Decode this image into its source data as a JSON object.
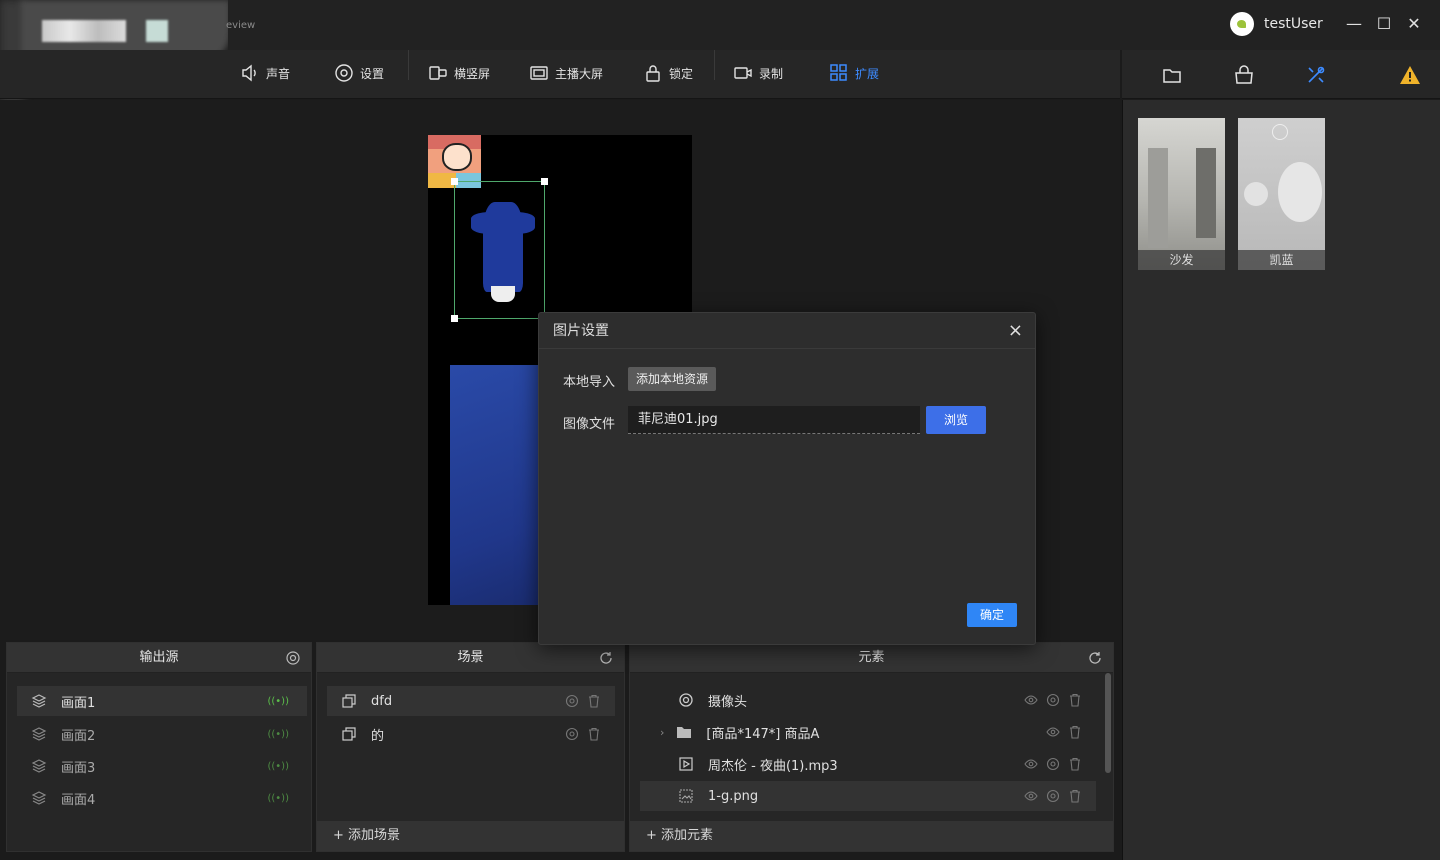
{
  "titlebar": {
    "preview_text": "eview",
    "username": "testUser",
    "minimize": "—",
    "maximize": "☐",
    "close": "✕"
  },
  "toolbar": {
    "items": [
      {
        "label": "声音",
        "icon": "speaker-icon"
      },
      {
        "label": "设置",
        "icon": "gear-icon"
      },
      {
        "label": "横竖屏",
        "icon": "rotate-screen-icon"
      },
      {
        "label": "主播大屏",
        "icon": "fullscreen-icon"
      },
      {
        "label": "锁定",
        "icon": "lock-icon"
      },
      {
        "label": "录制",
        "icon": "video-record-icon"
      },
      {
        "label": "扩展",
        "icon": "grid-icon",
        "active": true
      }
    ],
    "accent_color": "#3d8bff"
  },
  "right_panel": {
    "tabs": [
      "folder-icon",
      "shop-bag-icon",
      "tools-icon",
      "warning-icon"
    ],
    "assets": [
      {
        "label": "沙发"
      },
      {
        "label": "凯蓝"
      }
    ]
  },
  "panels": {
    "output": {
      "title": "输出源",
      "items": [
        {
          "label": "画面1",
          "selected": true
        },
        {
          "label": "画面2"
        },
        {
          "label": "画面3"
        },
        {
          "label": "画面4"
        }
      ]
    },
    "scenes": {
      "title": "场景",
      "items": [
        {
          "label": "dfd",
          "selected": true
        },
        {
          "label": "的"
        }
      ],
      "add_label": "添加场景"
    },
    "elements": {
      "title": "元素",
      "items": [
        {
          "label": "摄像头",
          "icon": "camera-icon"
        },
        {
          "label": "[商品*147*] 商品A",
          "icon": "folder-icon"
        },
        {
          "label": "周杰伦 - 夜曲(1).mp3",
          "icon": "play-icon"
        },
        {
          "label": "1-g.png",
          "icon": "image-icon",
          "selected": true
        }
      ],
      "add_label": "添加元素"
    }
  },
  "dialog": {
    "title": "图片设置",
    "local_import_label": "本地导入",
    "add_local_button": "添加本地资源",
    "image_file_label": "图像文件",
    "image_file_value": "菲尼迪01.jpg",
    "browse_button": "浏览",
    "confirm_button": "确定"
  }
}
